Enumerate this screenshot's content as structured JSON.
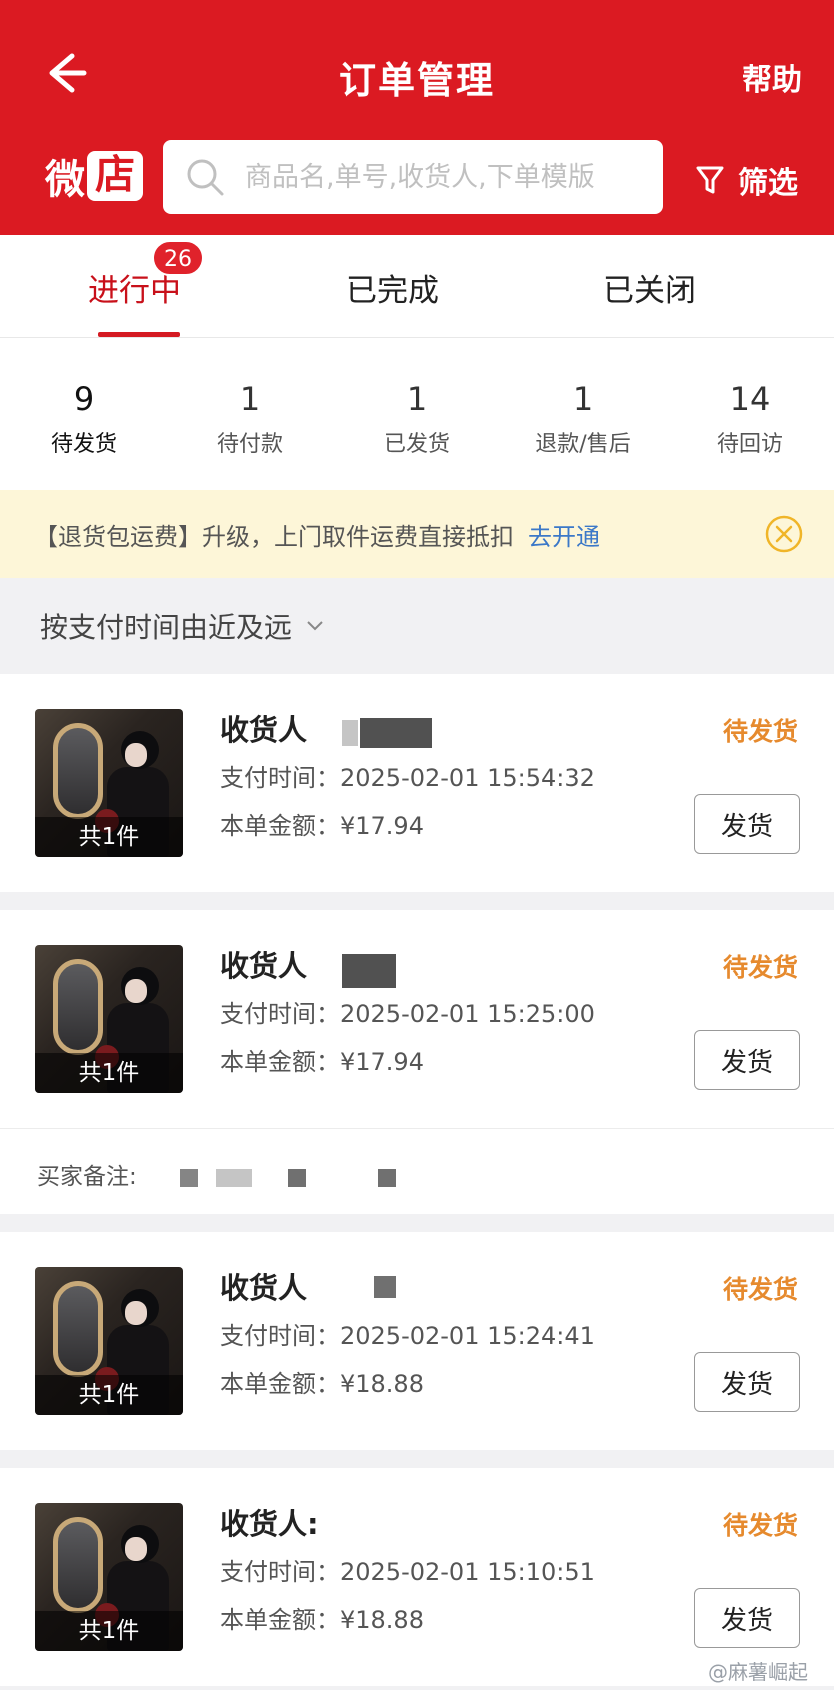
{
  "header": {
    "title": "订单管理",
    "help": "帮助",
    "logo_left": "微",
    "logo_box": "店",
    "search_placeholder": "商品名,单号,收货人,下单模版",
    "filter": "筛选"
  },
  "tabs": [
    {
      "label": "进行中",
      "badge": "26",
      "active": true
    },
    {
      "label": "已完成"
    },
    {
      "label": "已关闭"
    }
  ],
  "stats": [
    {
      "num": "9",
      "label": "待发货"
    },
    {
      "num": "1",
      "label": "待付款"
    },
    {
      "num": "1",
      "label": "已发货"
    },
    {
      "num": "1",
      "label": "退款/售后"
    },
    {
      "num": "14",
      "label": "待回访"
    }
  ],
  "notice": {
    "text": "【退货包运费】升级，上门取件运费直接抵扣",
    "link": "去开通"
  },
  "sort": "按支付时间由近及远",
  "orders": [
    {
      "receiver": "收货人",
      "paytime": "支付时间：2025-02-01 15:54:32",
      "amount": "本单金额：¥17.94",
      "status": "待发货",
      "count": "共1件",
      "button": "发货"
    },
    {
      "receiver": "收货人",
      "paytime": "支付时间：2025-02-01 15:25:00",
      "amount": "本单金额：¥17.94",
      "status": "待发货",
      "count": "共1件",
      "button": "发货"
    },
    {
      "receiver": "收货人",
      "paytime": "支付时间：2025-02-01 15:24:41",
      "amount": "本单金额：¥18.88",
      "status": "待发货",
      "count": "共1件",
      "button": "发货"
    },
    {
      "receiver": "收货人:",
      "paytime": "支付时间：2025-02-01 15:10:51",
      "amount": "本单金额：¥18.88",
      "status": "待发货",
      "count": "共1件",
      "button": "发货"
    }
  ],
  "remark": {
    "label": "买家备注:"
  },
  "watermark": "@麻薯崛起",
  "colors": {
    "brand_red": "#db1a22",
    "status_orange": "#e68a2e",
    "link_blue": "#3b78c8",
    "notice_bg": "#fdf6d8"
  }
}
